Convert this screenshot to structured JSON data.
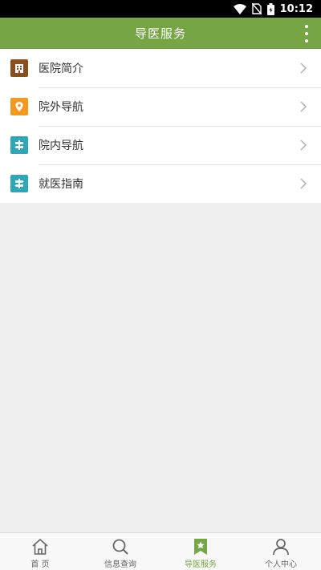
{
  "status_bar": {
    "time": "10:12"
  },
  "app_bar": {
    "title": "导医服务"
  },
  "colors": {
    "accent": "#76a545",
    "brown": "#8b4f1c",
    "orange": "#f39a1e",
    "teal": "#2ea8b8"
  },
  "list": {
    "items": [
      {
        "label": "医院简介",
        "icon": "hospital-building-icon"
      },
      {
        "label": "院外导航",
        "icon": "location-pin-icon"
      },
      {
        "label": "院内导航",
        "icon": "signpost-icon"
      },
      {
        "label": "就医指南",
        "icon": "signpost-icon"
      }
    ]
  },
  "tabs": [
    {
      "label": "首 页",
      "icon": "home-icon",
      "active": false
    },
    {
      "label": "信息查询",
      "icon": "search-icon",
      "active": false
    },
    {
      "label": "导医服务",
      "icon": "bookmark-star-icon",
      "active": true
    },
    {
      "label": "个人中心",
      "icon": "person-icon",
      "active": false
    }
  ]
}
